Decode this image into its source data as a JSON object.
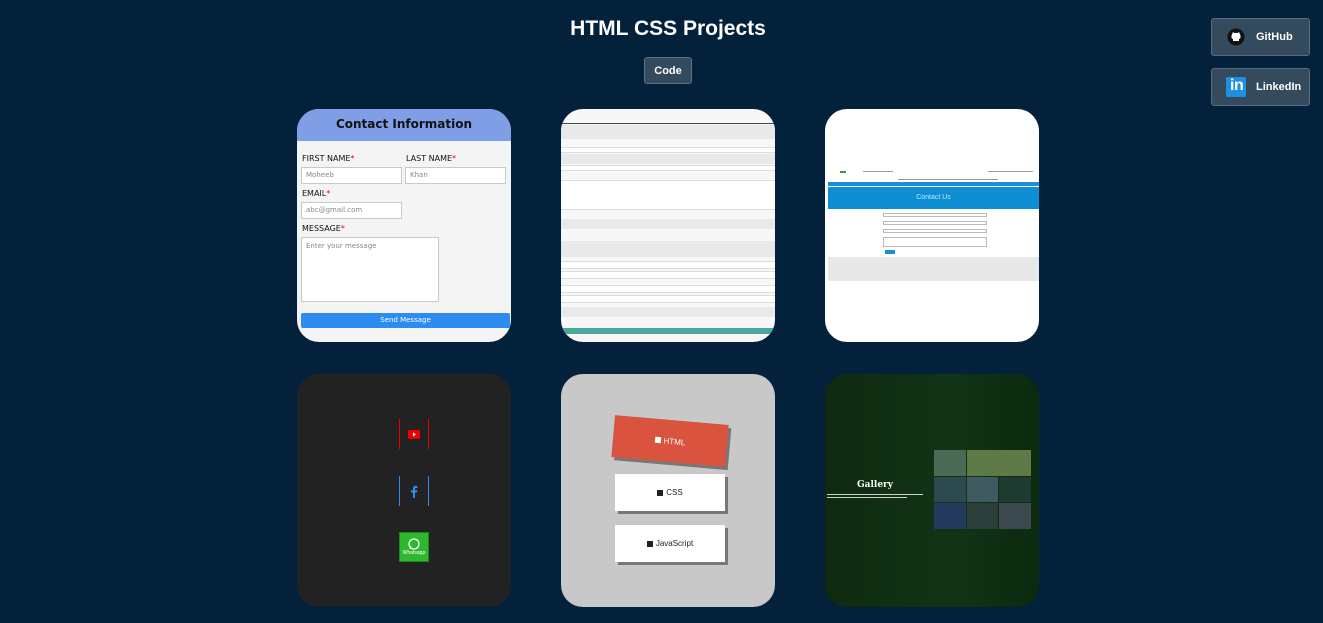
{
  "header": {
    "title": "HTML CSS Projects",
    "code_label": "Code"
  },
  "social": {
    "github_label": "GitHub",
    "linkedin_label": "LinkedIn",
    "linkedin_logo": "in"
  },
  "colors": {
    "background": "#03213a",
    "button": "#344a5d"
  },
  "projects": [
    {
      "name": "contact-form",
      "title": "Contact Information",
      "first_name_label": "FIRST NAME",
      "first_name_value": "Moheeb",
      "last_name_label": "LAST NAME",
      "last_name_value": "Khan",
      "email_label": "EMAIL",
      "email_value": "abc@gmail.com",
      "message_label": "MESSAGE",
      "message_placeholder": "Enter your message",
      "required_mark": "*",
      "send_label": "Send Message"
    },
    {
      "name": "document-page"
    },
    {
      "name": "contact-us-site",
      "hero": "Contact Us"
    },
    {
      "name": "social-icons",
      "whatsapp_label": "Whatsapp"
    },
    {
      "name": "skills",
      "skills": [
        "HTML",
        "CSS",
        "JavaScript"
      ]
    },
    {
      "name": "gallery",
      "title": "Gallery"
    }
  ]
}
